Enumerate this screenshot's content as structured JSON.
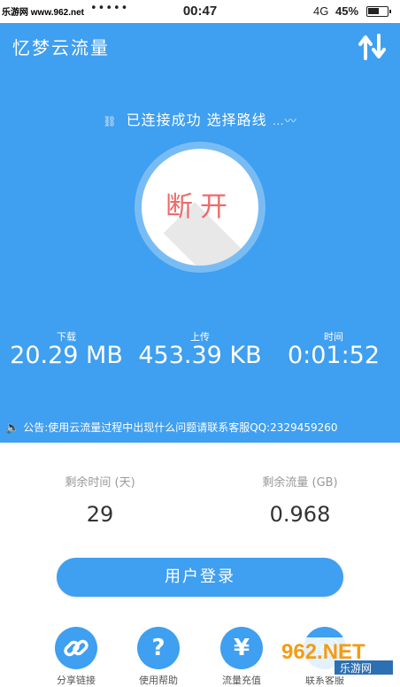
{
  "status_bar": {
    "time": "00:47",
    "network": "4G",
    "battery": "45%",
    "signal_dots": "•••••"
  },
  "header": {
    "app_title": "忆梦云流量",
    "switch_icon": "up-down-arrows-icon"
  },
  "connection": {
    "status_text": "已连接成功 选择路线",
    "link_icon": "link-icon"
  },
  "disconnect_button": {
    "label": "断开"
  },
  "stats": {
    "download_label": "下载",
    "download_value": "20.29 MB",
    "upload_label": "上传",
    "upload_value": "453.39 KB",
    "time_label": "时间",
    "time_value": "0:01:52"
  },
  "notice": {
    "text": "公告:使用云流量过程中出现什么问题请联系客服QQ:2329459260"
  },
  "remaining": {
    "time_label": "剩余时间 (天)",
    "time_value": "29",
    "traffic_label": "剩余流量 (GB)",
    "traffic_value": "0.968"
  },
  "login_button": {
    "label": "用户登录"
  },
  "dock": [
    {
      "icon": "link-icon",
      "glyph": "🔗",
      "label": "分享链接"
    },
    {
      "icon": "question-icon",
      "glyph": "?",
      "label": "使用帮助"
    },
    {
      "icon": "yen-icon",
      "glyph": "¥",
      "label": "流量充值"
    },
    {
      "icon": "phone-icon",
      "glyph": "☏",
      "label": "联系客服"
    }
  ],
  "watermark": {
    "top_left": "乐游网 www.962.net",
    "bottom_right_brand": "962.NET",
    "bottom_right_sub": "乐游网"
  },
  "colors": {
    "accent": "#3f9ff0",
    "disconnect_text": "#ee6b6b",
    "muted_text": "#999999"
  }
}
